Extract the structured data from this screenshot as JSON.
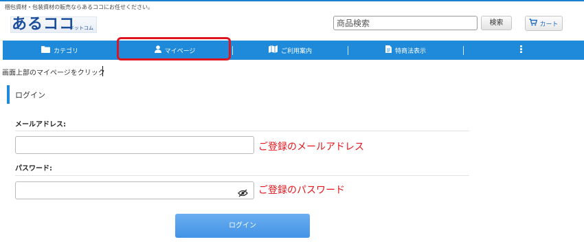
{
  "header": {
    "tagline": "梱包資材・包装資材の販売ならあるココにお任せください。",
    "logo_main": "あるココ",
    "logo_sub": "ドットコム",
    "search": {
      "placeholder": "商品検索",
      "button_label": "検索"
    },
    "cart_label": "カート"
  },
  "nav": {
    "items": [
      {
        "label": "カテゴリ",
        "icon": "folder-icon"
      },
      {
        "label": "マイページ",
        "icon": "user-icon"
      },
      {
        "label": "ご利用案内",
        "icon": "map-icon"
      },
      {
        "label": "特商法表示",
        "icon": "document-icon"
      },
      {
        "label": "",
        "icon": "more-vertical-icon"
      }
    ],
    "highlighted_item": "マイページ"
  },
  "instruction": "画面上部のマイページをクリック",
  "login": {
    "title": "ログイン",
    "email_label": "メールアドレス:",
    "email_value": "",
    "email_note": "ご登録のメールアドレス",
    "password_label": "パスワード:",
    "password_value": "",
    "password_note": "ご登録のパスワード",
    "submit_label": "ログイン"
  },
  "colors": {
    "accent": "#1f8ad9",
    "highlight_border": "#e0141e",
    "note_text": "#e5141b",
    "login_button": "#4f9be9"
  }
}
